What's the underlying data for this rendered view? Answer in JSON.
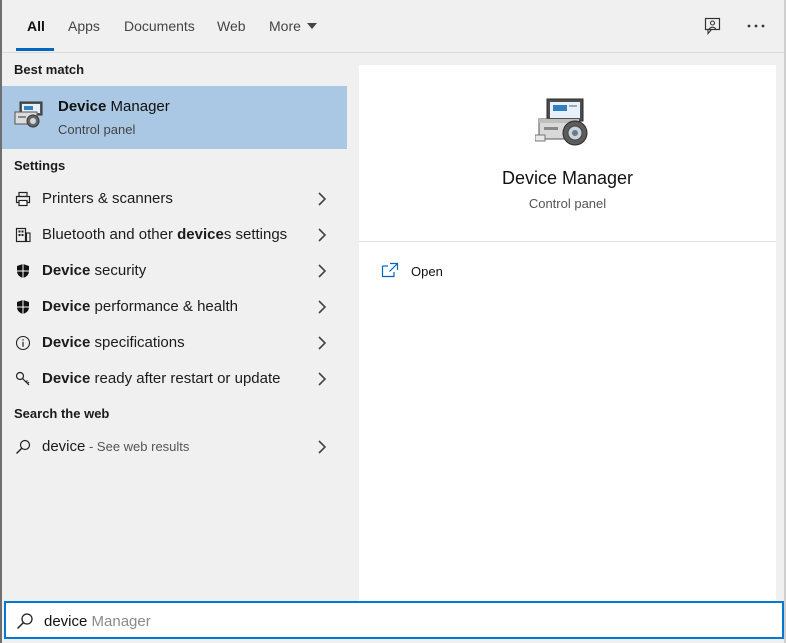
{
  "tabs": [
    {
      "label": "All",
      "active": true
    },
    {
      "label": "Apps"
    },
    {
      "label": "Documents"
    },
    {
      "label": "Web"
    },
    {
      "label": "More"
    }
  ],
  "header_icons": [
    "feedback-icon",
    "more-options-icon"
  ],
  "sections": {
    "best_match": "Best match",
    "settings": "Settings",
    "search_web": "Search the web"
  },
  "best_match": {
    "title_bold": "Device",
    "title_rest": " Manager",
    "subtitle": "Control panel",
    "icon": "device-manager-icon"
  },
  "settings_items": [
    {
      "pre": "",
      "bold": "",
      "post": "Printers & scanners",
      "icon": "printer-icon"
    },
    {
      "pre": "Bluetooth and other ",
      "bold": "device",
      "post": "s settings",
      "icon": "bluetooth-devices-icon"
    },
    {
      "pre": "",
      "bold": "Device",
      "post": " security",
      "icon": "shield-icon"
    },
    {
      "pre": "",
      "bold": "Device",
      "post": " performance & health",
      "icon": "shield-icon"
    },
    {
      "pre": "",
      "bold": "Device",
      "post": " specifications",
      "icon": "info-icon"
    },
    {
      "pre": "",
      "bold": "Device",
      "post": " ready after restart or update",
      "icon": "key-icon"
    }
  ],
  "web_result": {
    "query": "device",
    "sub": " - See web results",
    "icon": "search-icon"
  },
  "preview": {
    "title": "Device Manager",
    "subtitle": "Control panel",
    "actions": [
      {
        "label": "Open",
        "icon": "open-window-icon"
      }
    ]
  },
  "search": {
    "typed": "device",
    "completion": " Manager"
  },
  "colors": {
    "accent": "#0078d4",
    "selected_row": "#aac8e4",
    "background": "#f0f0f0"
  }
}
